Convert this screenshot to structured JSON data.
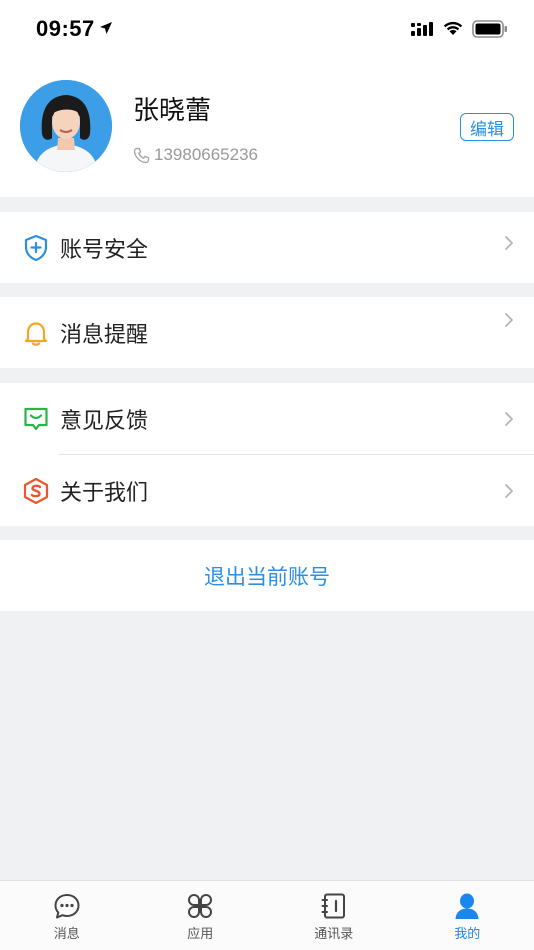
{
  "status_bar": {
    "time": "09:57"
  },
  "profile": {
    "name": "张晓蕾",
    "phone": "13980665236",
    "edit_label": "编辑"
  },
  "menu": {
    "account_security": "账号安全",
    "notifications": "消息提醒",
    "feedback": "意见反馈",
    "about": "关于我们"
  },
  "logout_label": "退出当前账号",
  "tabbar": {
    "tabs": [
      {
        "label": "消息",
        "icon": "chat-bubble-icon"
      },
      {
        "label": "应用",
        "icon": "apps-grid-icon"
      },
      {
        "label": "通讯录",
        "icon": "contacts-book-icon"
      },
      {
        "label": "我的",
        "icon": "person-icon",
        "active": true
      }
    ]
  },
  "colors": {
    "accent": "#2b8fe6",
    "tab_active": "#1a87f0",
    "bell": "#f5a623",
    "feedback": "#27b345",
    "about": "#e8582a",
    "background": "#f0f1f3"
  }
}
